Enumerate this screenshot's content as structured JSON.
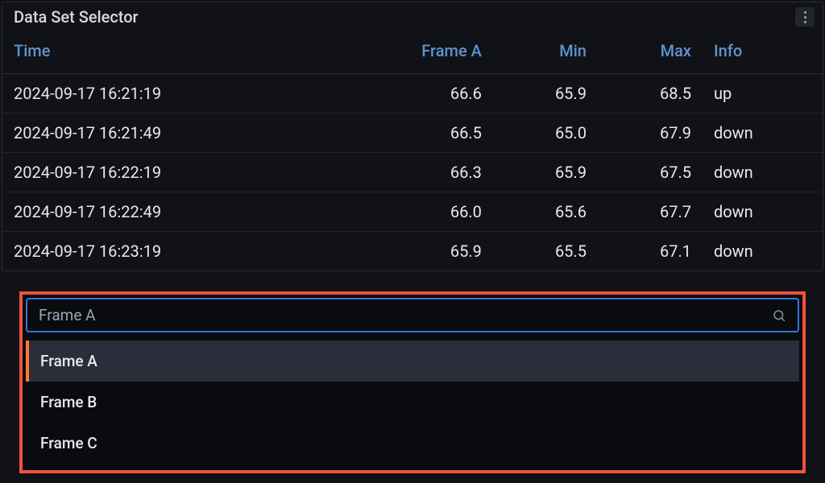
{
  "panel": {
    "title": "Data Set Selector"
  },
  "table": {
    "headers": {
      "time": "Time",
      "frameA": "Frame A",
      "min": "Min",
      "max": "Max",
      "info": "Info"
    },
    "rows": [
      {
        "time": "2024-09-17 16:21:19",
        "frameA": "66.6",
        "min": "65.9",
        "max": "68.5",
        "info": "up"
      },
      {
        "time": "2024-09-17 16:21:49",
        "frameA": "66.5",
        "min": "65.0",
        "max": "67.9",
        "info": "down"
      },
      {
        "time": "2024-09-17 16:22:19",
        "frameA": "66.3",
        "min": "65.9",
        "max": "67.5",
        "info": "down"
      },
      {
        "time": "2024-09-17 16:22:49",
        "frameA": "66.0",
        "min": "65.6",
        "max": "67.7",
        "info": "down"
      },
      {
        "time": "2024-09-17 16:23:19",
        "frameA": "65.9",
        "min": "65.5",
        "max": "67.1",
        "info": "down"
      }
    ]
  },
  "selector": {
    "search": "Frame A",
    "options": [
      {
        "label": "Frame A",
        "selected": true
      },
      {
        "label": "Frame B",
        "selected": false
      },
      {
        "label": "Frame C",
        "selected": false
      }
    ]
  }
}
